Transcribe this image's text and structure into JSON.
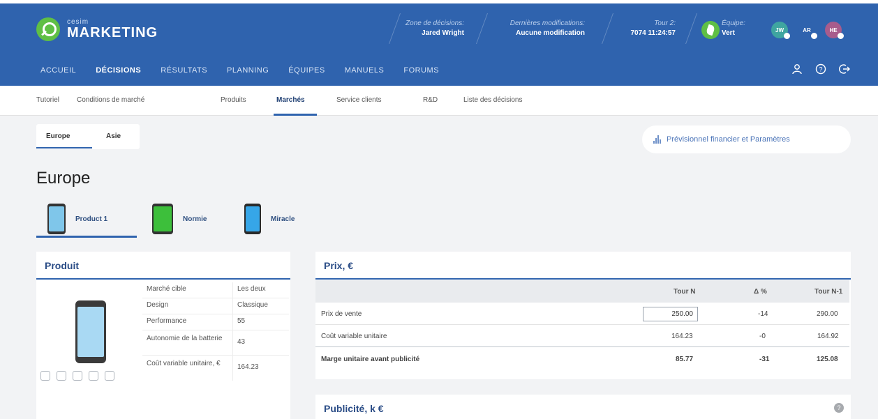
{
  "app": {
    "brand_small": "cesim",
    "brand_big": "MARKETING"
  },
  "header_info": {
    "zone_label": "Zone de décisions:",
    "zone_value": "Jared Wright",
    "modif_label": "Dernières modifications:",
    "modif_value": "Aucune modification",
    "tour_label": "Tour 2:",
    "tour_value": "7074 11:24:57",
    "team_label": "Équipe:",
    "team_value": "Vert"
  },
  "avatars": [
    {
      "initials": "JW",
      "color": "#3fa5a0"
    },
    {
      "initials": "AR",
      "color": "#2f63ae"
    },
    {
      "initials": "HE",
      "color": "#a85c8c"
    }
  ],
  "main_nav": [
    "ACCUEIL",
    "DÉCISIONS",
    "RÉSULTATS",
    "PLANNING",
    "ÉQUIPES",
    "MANUELS",
    "FORUMS"
  ],
  "main_nav_active": "DÉCISIONS",
  "sub_nav": [
    "Tutoriel",
    "Conditions de marché",
    "Produits",
    "Marchés",
    "Service clients",
    "R&D",
    "Liste des décisions"
  ],
  "sub_nav_active": "Marchés",
  "region_tabs": [
    "Europe",
    "Asie"
  ],
  "fin_button": "Prévisionnel financier et Paramètres",
  "region_title": "Europe",
  "product_tabs": [
    {
      "label": "Product 1",
      "color": "#7fc6ea"
    },
    {
      "label": "Normie",
      "color": "#3dbf3b"
    },
    {
      "label": "Miracle",
      "color": "#36a6e8"
    }
  ],
  "produit_card": {
    "title": "Produit",
    "specs": [
      {
        "k": "Marché cible",
        "v": "Les deux"
      },
      {
        "k": "Design",
        "v": "Classique"
      },
      {
        "k": "Performance",
        "v": "55"
      },
      {
        "k": "Autonomie de la batterie",
        "v": "43"
      },
      {
        "k": "Coût variable unitaire, €",
        "v": "164.23"
      }
    ]
  },
  "prix_card": {
    "title": "Prix, €",
    "columns": [
      "Tour N",
      "Δ %",
      "Tour N-1"
    ],
    "rows": [
      {
        "label": "Prix de vente",
        "tour_n": "250.00",
        "delta": "-14",
        "tour_n1": "290.00"
      },
      {
        "label": "Coût variable unitaire",
        "tour_n": "164.23",
        "delta": "-0",
        "tour_n1": "164.92"
      },
      {
        "label": "Marge unitaire avant publicité",
        "tour_n": "85.77",
        "delta": "-31",
        "tour_n1": "125.08"
      }
    ]
  },
  "pub_card": {
    "title": "Publicité, k €"
  }
}
